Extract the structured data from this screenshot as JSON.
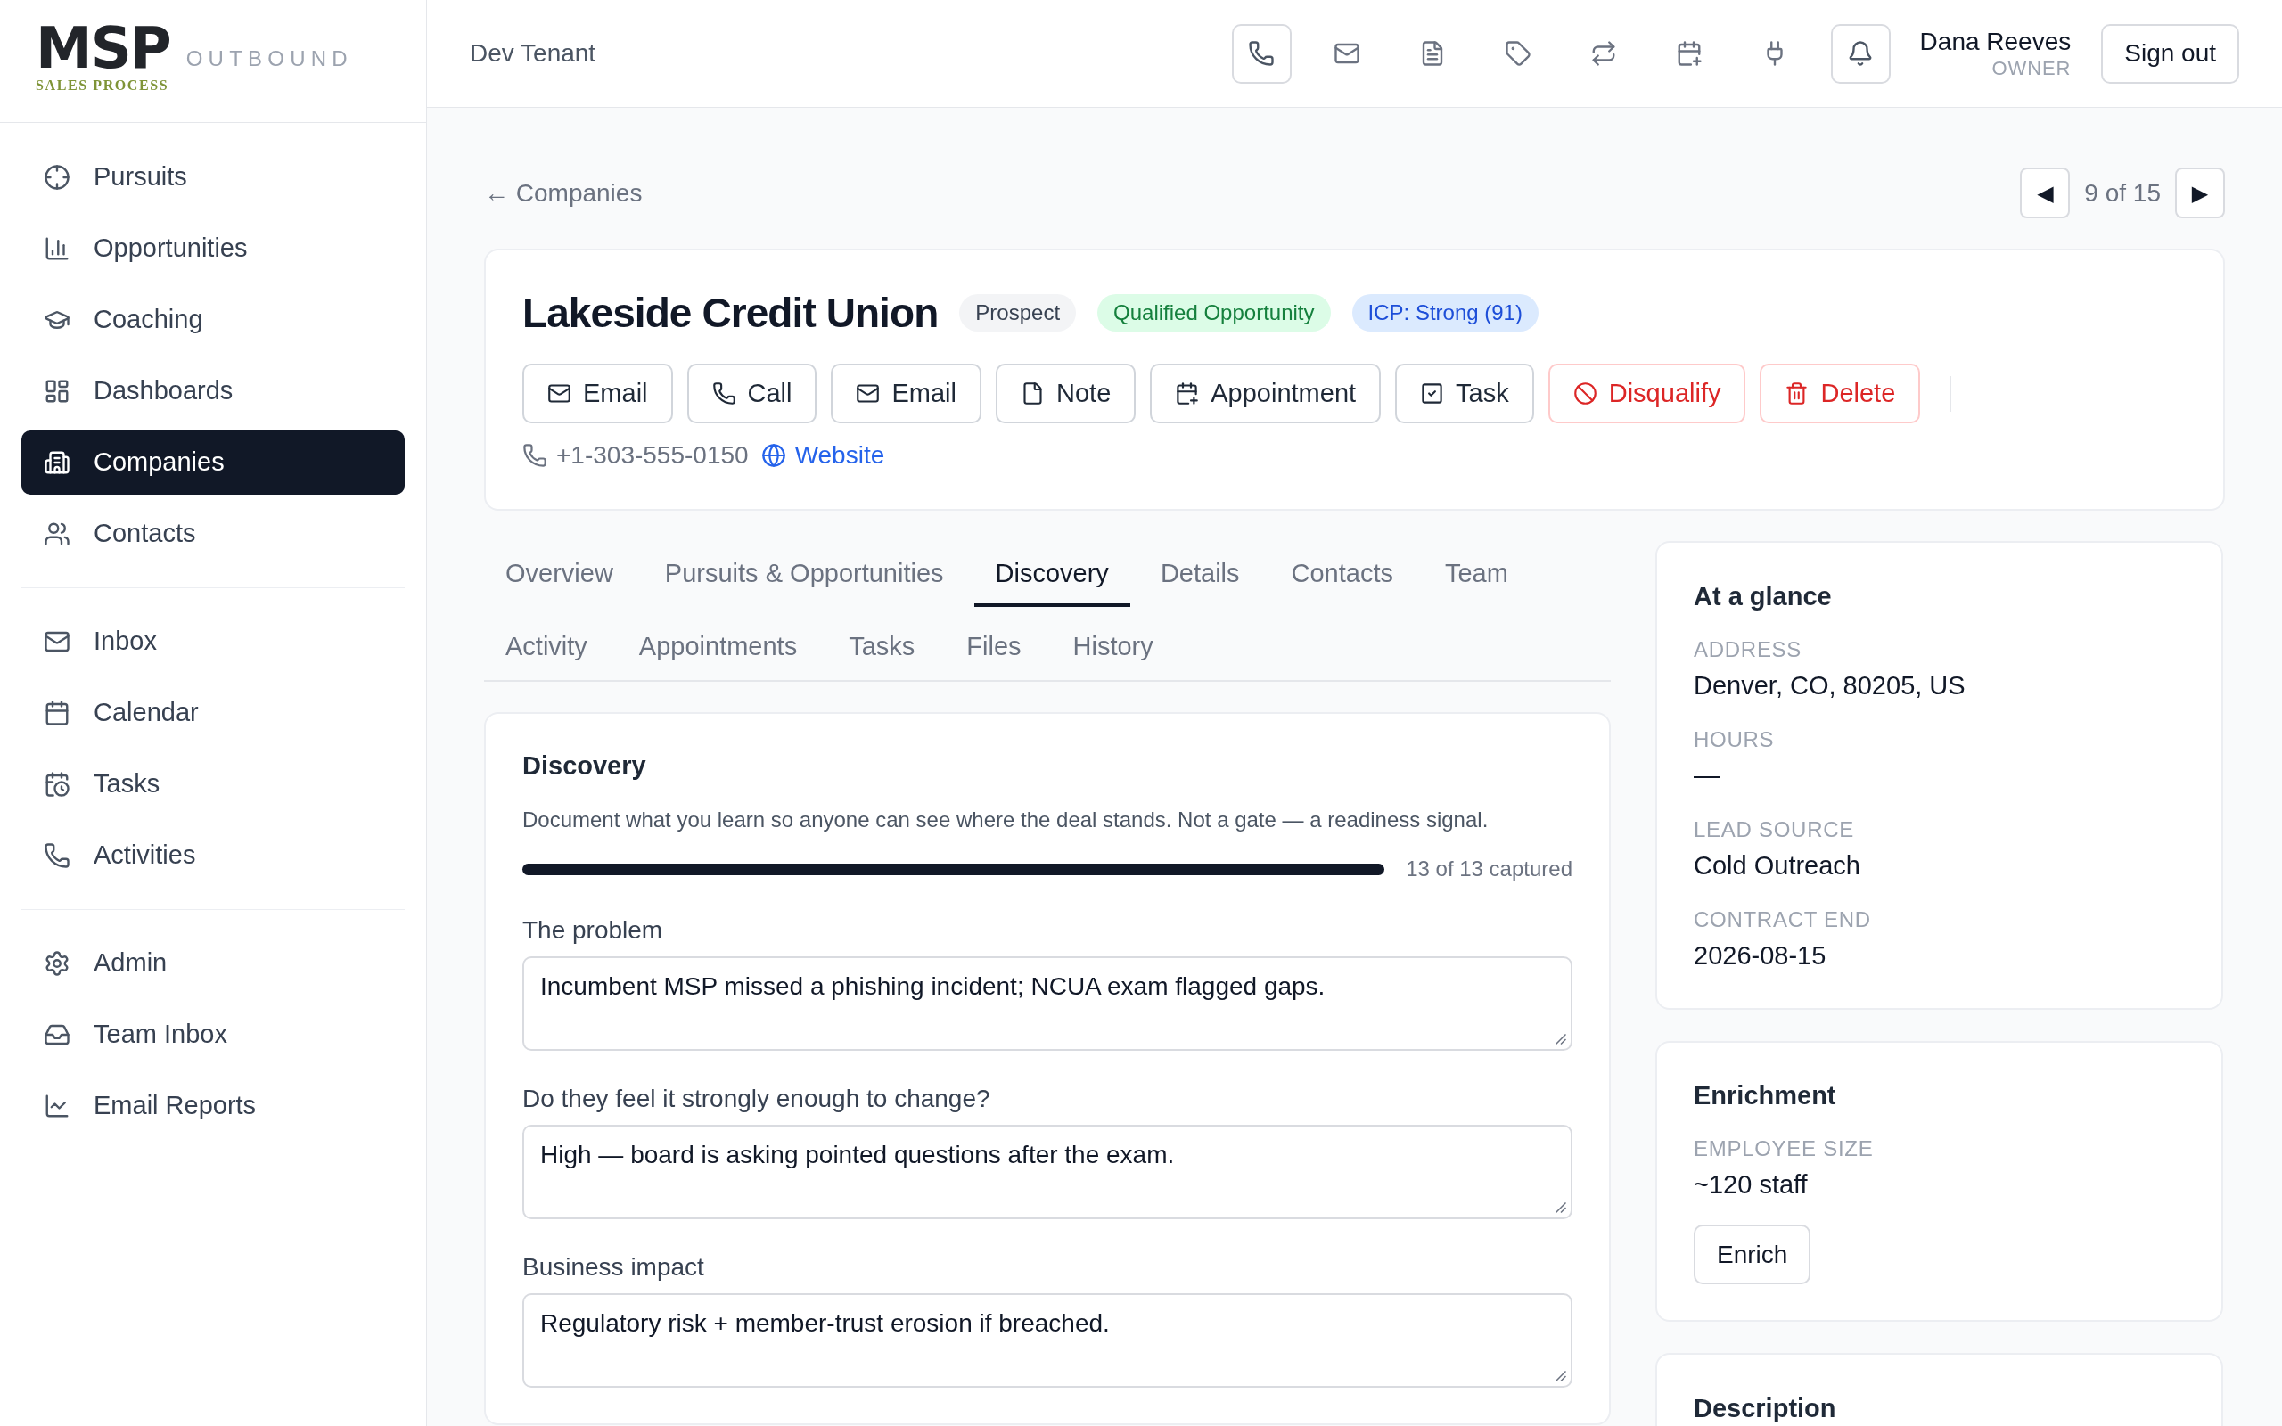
{
  "logo": {
    "wordmark": "MSP",
    "tagline": "SALES PROCESS",
    "product": "OUTBOUND"
  },
  "sidebar": {
    "groups": [
      {
        "items": [
          {
            "label": "Pursuits",
            "selected": false
          },
          {
            "label": "Opportunities",
            "selected": false
          },
          {
            "label": "Coaching",
            "selected": false
          },
          {
            "label": "Dashboards",
            "selected": false
          },
          {
            "label": "Companies",
            "selected": true
          },
          {
            "label": "Contacts",
            "selected": false
          }
        ]
      },
      {
        "items": [
          {
            "label": "Inbox",
            "selected": false
          },
          {
            "label": "Calendar",
            "selected": false
          },
          {
            "label": "Tasks",
            "selected": false
          },
          {
            "label": "Activities",
            "selected": false
          }
        ]
      },
      {
        "items": [
          {
            "label": "Admin",
            "selected": false
          },
          {
            "label": "Team Inbox",
            "selected": false
          },
          {
            "label": "Email Reports",
            "selected": false
          }
        ]
      }
    ]
  },
  "header": {
    "tenant": "Dev Tenant",
    "tools": [
      {
        "kind": "framed"
      },
      {
        "kind": "plain"
      },
      {
        "kind": "plain"
      },
      {
        "kind": "plain"
      },
      {
        "kind": "plain"
      },
      {
        "kind": "plain"
      },
      {
        "kind": "plain"
      },
      {
        "kind": "framed"
      }
    ],
    "user": {
      "name": "Dana Reeves",
      "role": "OWNER"
    },
    "sign_out": "Sign out"
  },
  "breadcrumb": {
    "back": "← Companies"
  },
  "pager": {
    "previous": "◀",
    "position": "9 of 15",
    "next": "▶"
  },
  "company": {
    "name": "Lakeside Credit Union",
    "badges": [
      {
        "label": "Prospect",
        "kind": "neutral"
      },
      {
        "label": "Qualified Opportunity",
        "kind": "success"
      },
      {
        "label": "ICP: Strong (91)",
        "kind": "info"
      }
    ],
    "actions": [
      {
        "label": "Email",
        "kind": "default"
      },
      {
        "label": "Call",
        "kind": "default"
      },
      {
        "label": "Email",
        "kind": "default"
      },
      {
        "label": "Note",
        "kind": "default"
      },
      {
        "label": "Appointment",
        "kind": "default"
      },
      {
        "label": "Task",
        "kind": "default"
      },
      {
        "label": "Disqualify",
        "kind": "danger"
      },
      {
        "label": "Delete",
        "kind": "danger"
      }
    ],
    "phone": "+1-303-555-0150",
    "website": "Website"
  },
  "tabs": {
    "rows": [
      {
        "items": [
          {
            "label": "Overview",
            "selected": false
          },
          {
            "label": "Pursuits & Opportunities",
            "selected": false
          },
          {
            "label": "Discovery",
            "selected": true
          },
          {
            "label": "Details",
            "selected": false
          },
          {
            "label": "Contacts",
            "selected": false
          },
          {
            "label": "Team",
            "selected": false
          }
        ]
      },
      {
        "items": [
          {
            "label": "Activity",
            "selected": false
          },
          {
            "label": "Appointments",
            "selected": false
          },
          {
            "label": "Tasks",
            "selected": false
          },
          {
            "label": "Files",
            "selected": false
          },
          {
            "label": "History",
            "selected": false
          }
        ]
      }
    ]
  },
  "discovery": {
    "title": "Discovery",
    "intro": "Document what you learn so anyone can see where the deal stands. Not a gate — a readiness signal.",
    "progress": {
      "level": 1,
      "reading": "13 of 13 captured"
    },
    "fields": [
      {
        "label": "The problem",
        "value": "Incumbent MSP missed a phishing incident; NCUA exam flagged gaps."
      },
      {
        "label": "Do they feel it strongly enough to change?",
        "value": "High — board is asking pointed questions after the exam."
      },
      {
        "label": "Business impact",
        "value": "Regulatory risk + member-trust erosion if breached."
      }
    ]
  },
  "glance": {
    "title": "At a glance",
    "facts": [
      {
        "label": "ADDRESS",
        "value": "Denver, CO, 80205, US"
      },
      {
        "label": "HOURS",
        "value": "—"
      },
      {
        "label": "LEAD SOURCE",
        "value": "Cold Outreach"
      },
      {
        "label": "CONTRACT END",
        "value": "2026-08-15"
      }
    ]
  },
  "enrichment": {
    "title": "Enrichment",
    "facts": [
      {
        "label": "EMPLOYEE SIZE",
        "value": "~120 staff"
      }
    ],
    "button": "Enrich"
  },
  "description": {
    "title": "Description"
  }
}
